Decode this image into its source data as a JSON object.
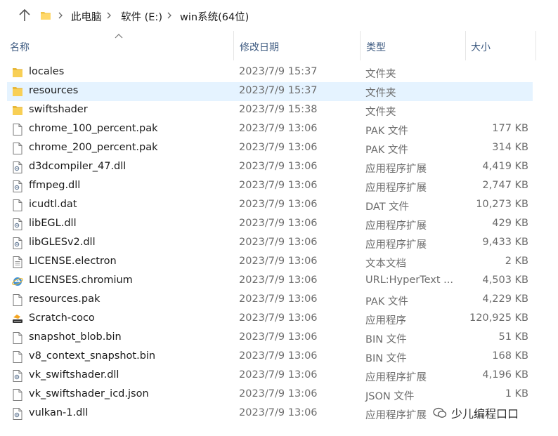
{
  "address_bar": {
    "crumbs": [
      "此电脑",
      "软件 (E:)",
      "win系统(64位)"
    ]
  },
  "columns": {
    "name": "名称",
    "date": "修改日期",
    "type": "类型",
    "size": "大小"
  },
  "files": [
    {
      "name": "locales",
      "date": "2023/7/9 15:37",
      "type": "文件夹",
      "size": "",
      "icon": "folder-icon"
    },
    {
      "name": "resources",
      "date": "2023/7/9 15:37",
      "type": "文件夹",
      "size": "",
      "icon": "folder-icon",
      "selected": true
    },
    {
      "name": "swiftshader",
      "date": "2023/7/9 15:38",
      "type": "文件夹",
      "size": "",
      "icon": "folder-icon"
    },
    {
      "name": "chrome_100_percent.pak",
      "date": "2023/7/9 13:06",
      "type": "PAK 文件",
      "size": "177 KB",
      "icon": "file-icon"
    },
    {
      "name": "chrome_200_percent.pak",
      "date": "2023/7/9 13:06",
      "type": "PAK 文件",
      "size": "314 KB",
      "icon": "file-icon"
    },
    {
      "name": "d3dcompiler_47.dll",
      "date": "2023/7/9 13:06",
      "type": "应用程序扩展",
      "size": "4,419 KB",
      "icon": "dll-icon"
    },
    {
      "name": "ffmpeg.dll",
      "date": "2023/7/9 13:06",
      "type": "应用程序扩展",
      "size": "2,747 KB",
      "icon": "dll-icon"
    },
    {
      "name": "icudtl.dat",
      "date": "2023/7/9 13:06",
      "type": "DAT 文件",
      "size": "10,273 KB",
      "icon": "file-icon"
    },
    {
      "name": "libEGL.dll",
      "date": "2023/7/9 13:06",
      "type": "应用程序扩展",
      "size": "429 KB",
      "icon": "dll-icon"
    },
    {
      "name": "libGLESv2.dll",
      "date": "2023/7/9 13:06",
      "type": "应用程序扩展",
      "size": "9,433 KB",
      "icon": "dll-icon"
    },
    {
      "name": "LICENSE.electron",
      "date": "2023/7/9 13:06",
      "type": "文本文档",
      "size": "2 KB",
      "icon": "text-file-icon"
    },
    {
      "name": "LICENSES.chromium",
      "date": "2023/7/9 13:06",
      "type": "URL:HyperText ...",
      "size": "4,503 KB",
      "icon": "ie-icon"
    },
    {
      "name": "resources.pak",
      "date": "2023/7/9 13:06",
      "type": "PAK 文件",
      "size": "4,229 KB",
      "icon": "file-icon"
    },
    {
      "name": "Scratch-coco",
      "date": "2023/7/9 13:06",
      "type": "应用程序",
      "size": "120,925 KB",
      "icon": "app-icon"
    },
    {
      "name": "snapshot_blob.bin",
      "date": "2023/7/9 13:06",
      "type": "BIN 文件",
      "size": "51 KB",
      "icon": "file-icon"
    },
    {
      "name": "v8_context_snapshot.bin",
      "date": "2023/7/9 13:06",
      "type": "BIN 文件",
      "size": "168 KB",
      "icon": "file-icon"
    },
    {
      "name": "vk_swiftshader.dll",
      "date": "2023/7/9 13:06",
      "type": "应用程序扩展",
      "size": "4,196 KB",
      "icon": "dll-icon"
    },
    {
      "name": "vk_swiftshader_icd.json",
      "date": "2023/7/9 13:06",
      "type": "JSON 文件",
      "size": "1 KB",
      "icon": "file-icon"
    },
    {
      "name": "vulkan-1.dll",
      "date": "2023/7/9 13:06",
      "type": "应用程序扩展",
      "size": "",
      "icon": "dll-icon"
    }
  ],
  "watermark": {
    "text": "少儿编程口口"
  },
  "colors": {
    "folder": "#f0c346",
    "selection": "#e5f3ff",
    "header_text": "#3d5a80"
  }
}
